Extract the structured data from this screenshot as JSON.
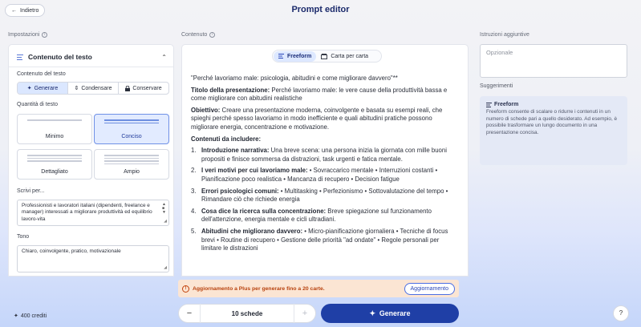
{
  "header": {
    "back_label": "Indietro",
    "title": "Prompt editor"
  },
  "sections": {
    "settings": "Impostazioni",
    "content": "Contenuto",
    "additional": "Istruzioni aggiuntive"
  },
  "left": {
    "panel_title": "Contenuto del testo",
    "mode_label": "Contenuto del testo",
    "modes": [
      "Generare",
      "Condensare",
      "Conservare"
    ],
    "selected_mode": "Generare",
    "quantity_label": "Quantità di testo",
    "quantities": [
      "Minimo",
      "Conciso",
      "Dettagliato",
      "Ampio"
    ],
    "selected_quantity": "Conciso",
    "audience_label": "Scrivi per...",
    "audience_value": "Professionisti e lavoratori italiani (dipendenti, freelance e manager) interessati a migliorare produttività ed equilibrio lavoro-vita",
    "tone_label": "Tono",
    "tone_value": "Chiaro, coinvolgente, pratico, motivazionale"
  },
  "center": {
    "views": [
      "Freeform",
      "Carta per carta"
    ],
    "active_view": "Freeform",
    "heading_line": "\"Perché lavoriamo male: psicologia, abitudini e come migliorare davvero\"**",
    "title_label": "Titolo della presentazione:",
    "title_value": " Perché lavoriamo male: le vere cause della produttività bassa e come migliorare con abitudini realistiche",
    "objective_label": "Obiettivo:",
    "objective_value": " Creare una presentazione moderna, coinvolgente e basata su esempi reali, che spieghi perché spesso lavoriamo in modo inefficiente e quali abitudini pratiche possono migliorare energia, concentrazione e motivazione.",
    "contents_label": "Contenuti da includere:",
    "items": [
      {
        "num": "1.",
        "label": "Introduzione narrativa:",
        "text": " Una breve scena: una persona inizia la giornata con mille buoni propositi e finisce sommersa da distrazioni, task urgenti e fatica mentale."
      },
      {
        "num": "2.",
        "label": "I veri motivi per cui lavoriamo male:",
        "text": " • Sovraccarico mentale • Interruzioni costanti • Pianificazione poco realistica • Mancanza di recupero • Decision fatigue"
      },
      {
        "num": "3.",
        "label": "Errori psicologici comuni:",
        "text": " • Multitasking • Perfezionismo • Sottovalutazione del tempo • Rimandare ciò che richiede energia"
      },
      {
        "num": "4.",
        "label": "Cosa dice la ricerca sulla concentrazione:",
        "text": " Breve spiegazione sul funzionamento dell'attenzione, energia mentale e cicli ultradiani."
      },
      {
        "num": "5.",
        "label": "Abitudini che migliorano davvero:",
        "text": " • Micro-pianificazione giornaliera • Tecniche di focus brevi • Routine di recupero • Gestione delle priorità \"ad ondate\" • Regole personali per limitare le distrazioni"
      }
    ]
  },
  "right": {
    "instructions_placeholder": "Opzionale",
    "suggestions_label": "Suggerimenti",
    "suggestion_title": "Freeform",
    "suggestion_text": "Freeform consente di scalare o ridurre i contenuti in un numero di schede pari a quello desiderato. Ad esempio, è possibile trasformare un lungo documento in una presentazione concisa."
  },
  "footer": {
    "credits": "400 crediti",
    "banner_text": "Aggiornamento a Plus per generare fino a 20 carte.",
    "upgrade_label": "Aggiornamento",
    "cards_value": "10 schede",
    "generate_label": "Generare",
    "help": "?"
  },
  "colors": {
    "primary": "#1f3fa6",
    "accent_light": "#dbe7ff",
    "warning_bg": "#fbe5d3",
    "warning_text": "#b8420e"
  }
}
